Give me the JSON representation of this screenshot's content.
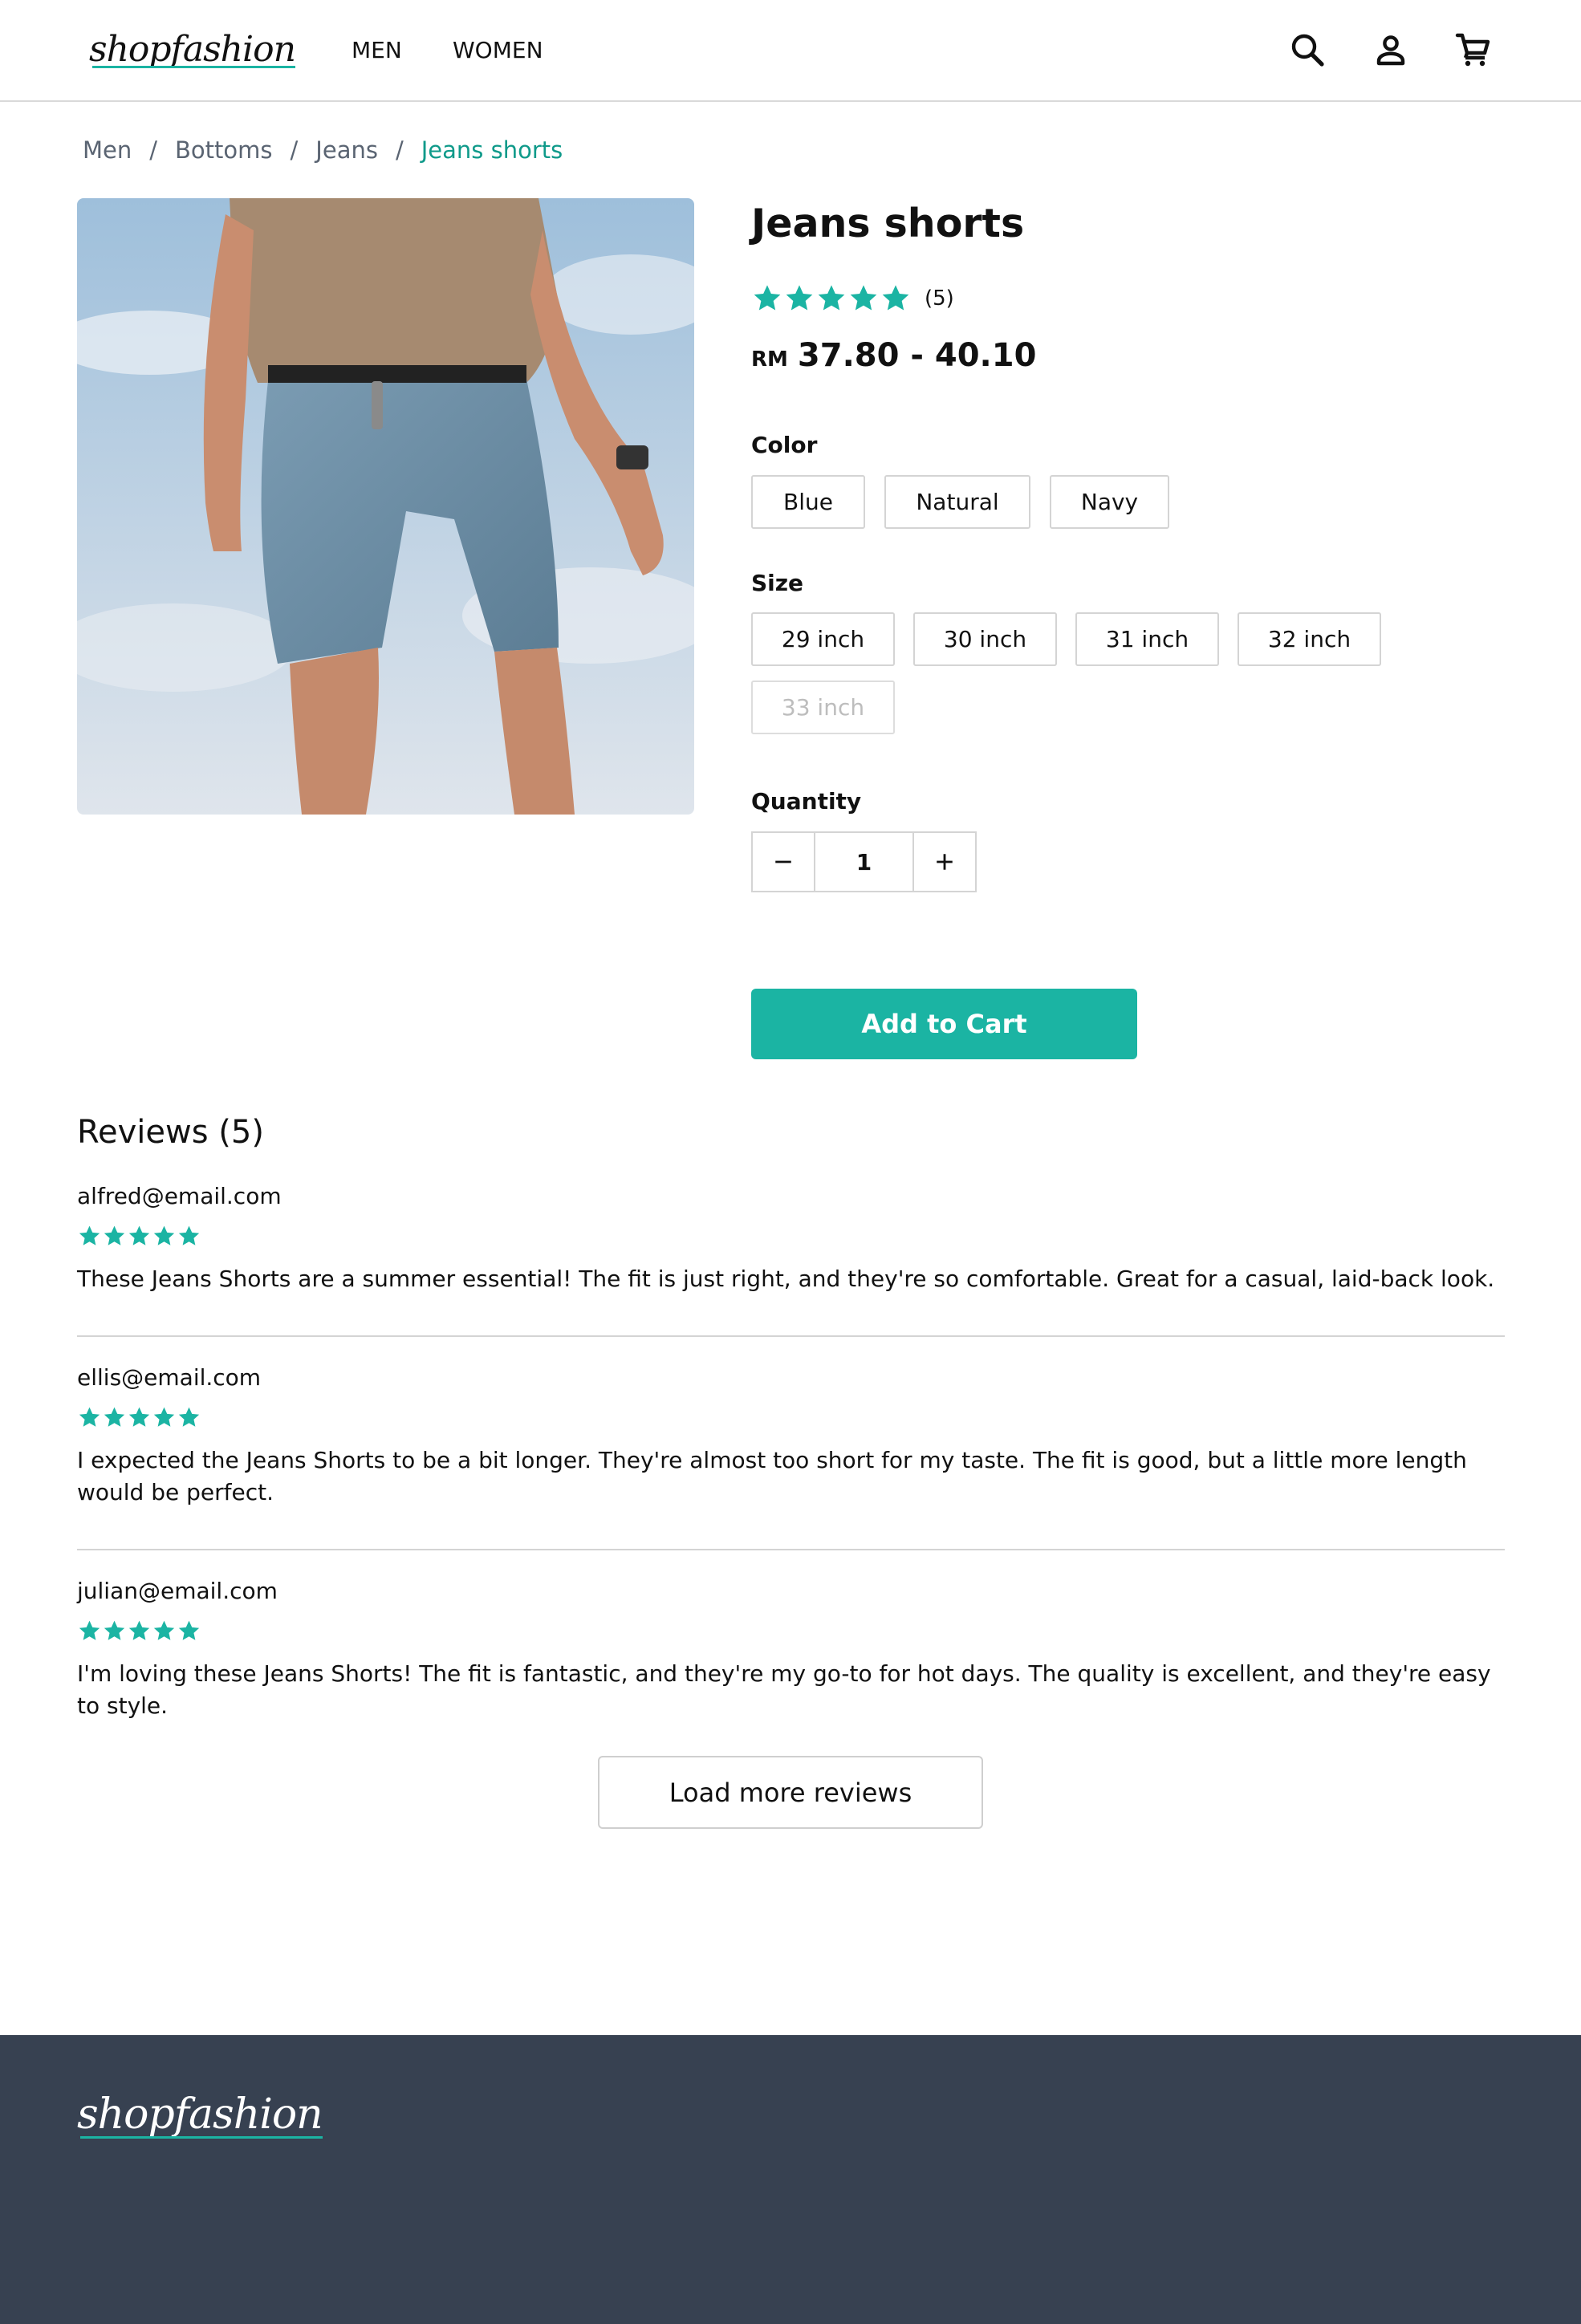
{
  "header": {
    "logo": "shopfashion",
    "nav": [
      "MEN",
      "WOMEN"
    ],
    "icons": [
      "search-icon",
      "user-icon",
      "cart-icon"
    ]
  },
  "breadcrumb": {
    "items": [
      "Men",
      "Bottoms",
      "Jeans"
    ],
    "current": "Jeans shorts",
    "separator": "/"
  },
  "product": {
    "title": "Jeans shorts",
    "rating": 5,
    "rating_count": "(5)",
    "currency": "RM",
    "price": "37.80 - 40.10",
    "color_label": "Color",
    "colors": [
      "Blue",
      "Natural",
      "Navy"
    ],
    "size_label": "Size",
    "sizes": [
      "29 inch",
      "30 inch",
      "31 inch",
      "32 inch",
      "33 inch"
    ],
    "unavailable_sizes": [
      "33 inch"
    ],
    "quantity_label": "Quantity",
    "quantity": "1",
    "add_to_cart": "Add to Cart"
  },
  "reviews": {
    "title": "Reviews (5)",
    "items": [
      {
        "email": "alfred@email.com",
        "rating": 5,
        "text": "These Jeans Shorts are a summer essential! The fit is just right, and they're so comfortable. Great for a casual, laid-back look."
      },
      {
        "email": "ellis@email.com",
        "rating": 5,
        "text": "I expected the Jeans Shorts to be a bit longer. They're almost too short for my taste. The fit is good, but a little more length would be perfect."
      },
      {
        "email": "julian@email.com",
        "rating": 5,
        "text": "I'm loving these Jeans Shorts! The fit is fantastic, and they're my go-to for hot days. The quality is excellent, and they're easy to style."
      }
    ],
    "load_more": "Load more reviews"
  },
  "footer": {
    "logo": "shopfashion"
  },
  "colors": {
    "accent": "#1bb4a3",
    "breadcrumb_current": "#0f9a8a",
    "footer_bg": "#374151"
  }
}
